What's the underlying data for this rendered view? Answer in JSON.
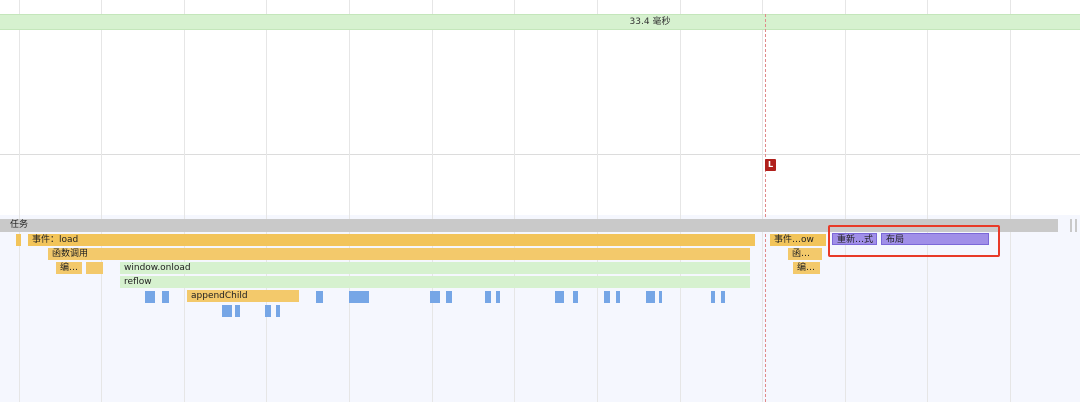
{
  "frame": {
    "duration_label": "33.4 毫秒"
  },
  "markers": {
    "load_marker_label": "L"
  },
  "flame": {
    "task_label": "任务",
    "event_load": "事件：load",
    "function_call": "函数调用",
    "compile": "编…",
    "window_onload": "window.onload",
    "reflow": "reflow",
    "append_child": "appendChild",
    "event_ow": "事件…ow",
    "function_short": "函…",
    "compile_short": "编…",
    "recalc_style": "重新…式",
    "layout": "布局"
  },
  "colors": {
    "frame_band": "#d6f1cf",
    "task": "#c9c9c9",
    "scripting": "#f2c45a",
    "green_call": "#d6f1cf",
    "rendering": "#a08fe8",
    "blue_calls": "#76a6e6",
    "highlight_box": "#e83a28",
    "load_marker": "#b0201c"
  }
}
